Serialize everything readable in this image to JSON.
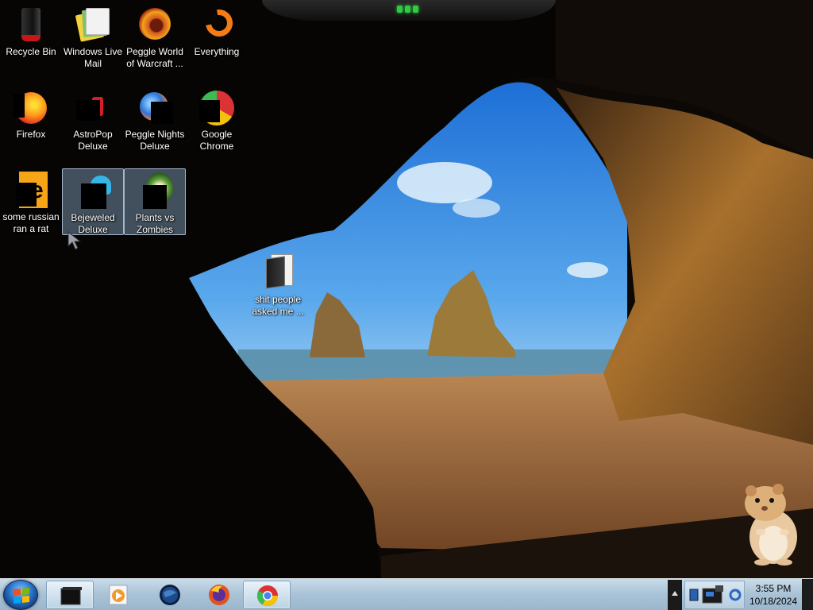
{
  "desktop": {
    "icons": [
      {
        "label": "Recycle Bin"
      },
      {
        "label": "Windows Live Mail"
      },
      {
        "label": "Peggle World of Warcraft ..."
      },
      {
        "label": "Everything"
      },
      {
        "label": "Firefox"
      },
      {
        "label": "AstroPop Deluxe"
      },
      {
        "label": "Peggle Nights Deluxe"
      },
      {
        "label": "Google Chrome"
      },
      {
        "label": "some russian ran a rat"
      },
      {
        "label": "Bejeweled Deluxe"
      },
      {
        "label": "Plants vs Zombies"
      },
      {
        "label": "shit people asked me ..."
      }
    ]
  },
  "taskbar": {
    "clock_time": "3:55 PM",
    "clock_date": "10/18/2024"
  },
  "colors": {
    "taskbar": "#a9c2d6",
    "selection": "#8caac8",
    "status_led": "#2ecc40"
  }
}
